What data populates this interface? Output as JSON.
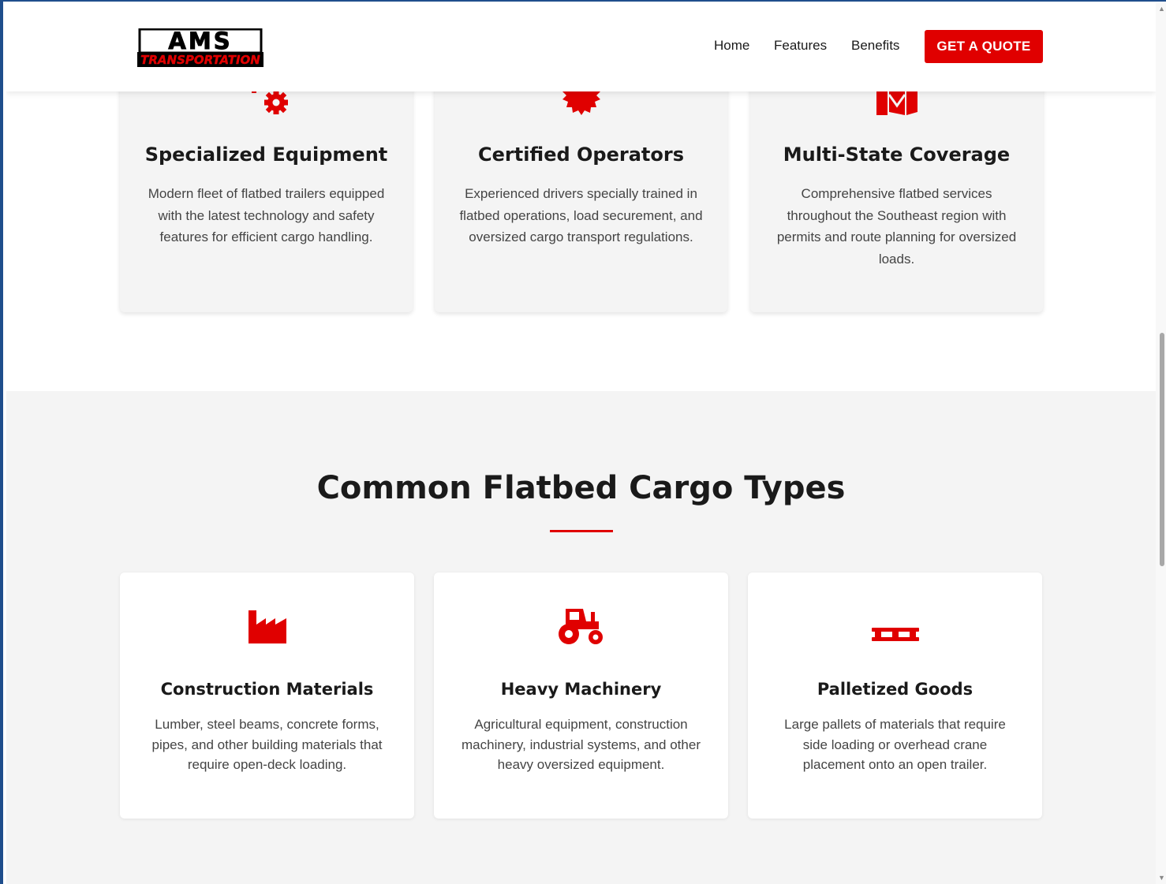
{
  "header": {
    "logo": {
      "line1": "AMS",
      "line2": "TRANSPORTATION"
    },
    "nav": [
      {
        "label": "Home"
      },
      {
        "label": "Features"
      },
      {
        "label": "Benefits"
      }
    ],
    "cta_label": "GET A QUOTE"
  },
  "features": [
    {
      "icon": "gears-icon",
      "title": "Specialized Equipment",
      "description": "Modern fleet of flatbed trailers equipped with the latest technology and safety features for efficient cargo handling."
    },
    {
      "icon": "certificate-badge-icon",
      "title": "Certified Operators",
      "description": "Experienced drivers specially trained in flatbed operations, load securement, and oversized cargo transport regulations."
    },
    {
      "icon": "map-location-icon",
      "title": "Multi-State Coverage",
      "description": "Comprehensive flatbed services throughout the Southeast region with permits and route planning for oversized loads."
    }
  ],
  "cargo": {
    "title": "Common Flatbed Cargo Types",
    "items": [
      {
        "icon": "industry-icon",
        "title": "Construction Materials",
        "description": "Lumber, steel beams, concrete forms, pipes, and other building materials that require open-deck loading."
      },
      {
        "icon": "tractor-icon",
        "title": "Heavy Machinery",
        "description": "Agricultural equipment, construction machinery, industrial systems, and other heavy oversized equipment."
      },
      {
        "icon": "pallet-icon",
        "title": "Palletized Goods",
        "description": "Large pallets of materials that require side loading or overhead crane placement onto an open trailer."
      }
    ]
  },
  "colors": {
    "accent": "#e00000",
    "section_bg": "#f4f4f4",
    "text_dark": "#1a1a1a",
    "text_body": "#444444"
  }
}
